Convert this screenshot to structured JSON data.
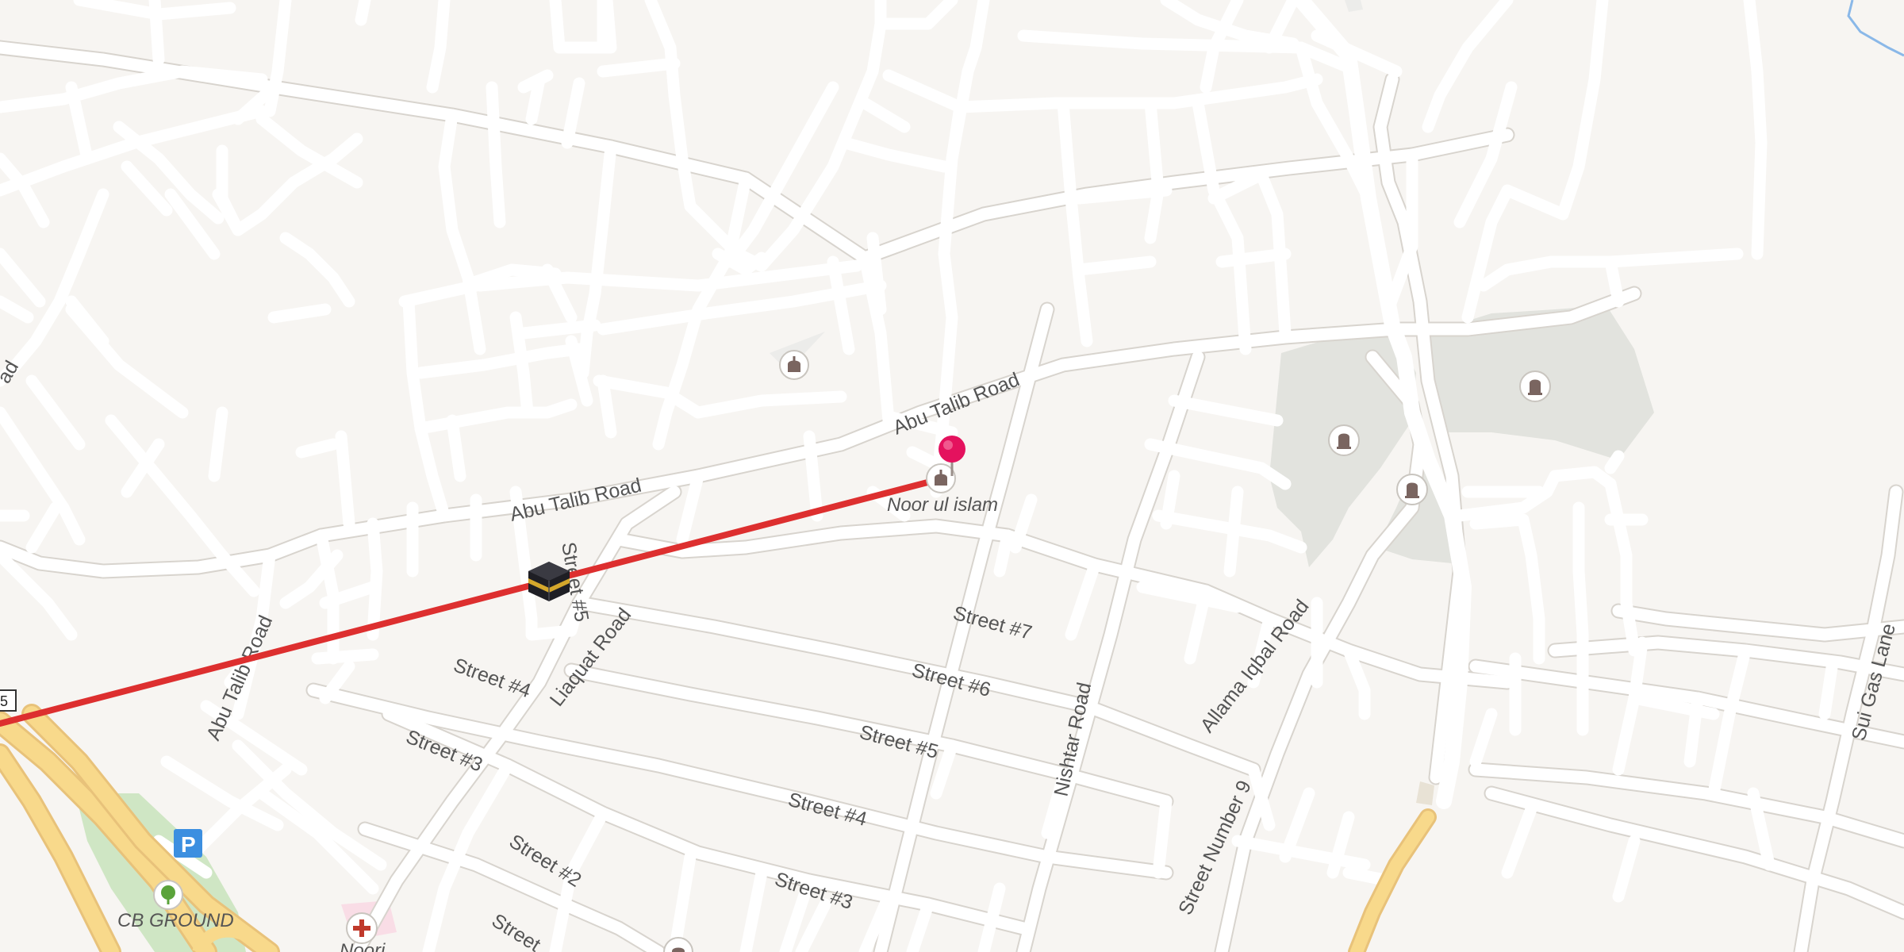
{
  "roads": {
    "abu_talib_road_1": "Abu Talib Road",
    "abu_talib_road_2": "Abu Talib Road",
    "abu_talib_road_3": "Abu Talib Road",
    "road_partial_left": "ad",
    "liaquat_road": "Liaquat Road",
    "nishtar_road": "Nishtar Road",
    "allama_iqbal_road": "Allama Iqbal Road",
    "sui_gas_lane": "Sui Gas Lane",
    "street_7": "Street #7",
    "street_6": "Street #6",
    "street_5": "Street #5",
    "street_5_vertical": "Street #5",
    "street_4a": "Street #4",
    "street_4b": "Street #4",
    "street_3a": "Street #3",
    "street_3b": "Street #3",
    "street_2": "Street #2",
    "street_partial": "Street",
    "street_number_9": "Street Number 9"
  },
  "places": {
    "noor_ul_islam": "Noor ul islam",
    "cb_ground": "CB GROUND",
    "noori_partial": "Noori"
  },
  "route_shield": "5",
  "icons": {
    "pin": "location-pin-icon",
    "kaaba": "kaaba-icon",
    "mosque": "mosque-icon",
    "cemetery": "cemetery-icon",
    "parking": "parking-icon",
    "park": "tree-icon",
    "hospital": "hospital-cross-icon"
  },
  "colors": {
    "background": "#f7f5f2",
    "route_line": "#dd2f2f",
    "pin": "#e4125e",
    "cemetery_area": "#e2e3de",
    "parking": "#3c8fe0",
    "highway": "#f8d98b"
  }
}
